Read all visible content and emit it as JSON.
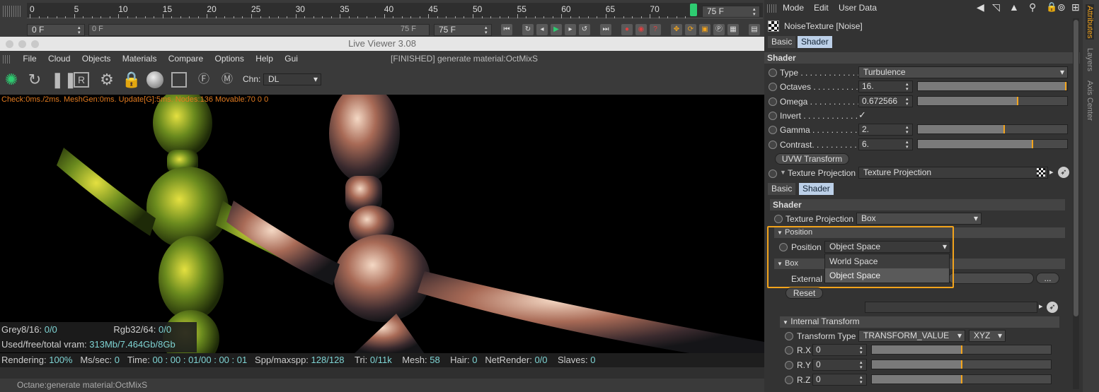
{
  "timeline": {
    "ticks": [
      "0",
      "5",
      "10",
      "15",
      "20",
      "25",
      "30",
      "35",
      "40",
      "45",
      "50",
      "55",
      "60",
      "65",
      "70"
    ],
    "end_frame": "75 F",
    "start_field": "0 F",
    "range_start": "0 F",
    "range_end": "75 F",
    "max_field": "75 F"
  },
  "viewer": {
    "window_title": "Live Viewer 3.08",
    "status_title": "[FINISHED] generate material:OctMixS",
    "menu": [
      "File",
      "Cloud",
      "Objects",
      "Materials",
      "Compare",
      "Options",
      "Help",
      "Gui"
    ],
    "channel_label": "Chn:",
    "channel_value": "DL",
    "check_line": "Check:0ms./2ms. MeshGen:0ms. Update[G]:5ms. Nodes:136 Movable:70  0 0",
    "grey_label": "Grey8/16:",
    "grey_value": "0/0",
    "rgb_label": "Rgb32/64:",
    "rgb_value": "0/0",
    "vram_label": "Used/free/total vram:",
    "vram_value": "313Mb/7.464Gb/8Gb"
  },
  "stats": {
    "rendering_label": "Rendering:",
    "rendering": "100%",
    "mssec_label": "Ms/sec:",
    "mssec": "0",
    "time_label": "Time:",
    "time": "00 : 00 : 01/00 : 00 : 01",
    "spp_label": "Spp/maxspp:",
    "spp": "128/128",
    "tri_label": "Tri:",
    "tri": "0/11k",
    "mesh_label": "Mesh:",
    "mesh": "58",
    "hair_label": "Hair:",
    "hair": "0",
    "netrender_label": "NetRender:",
    "netrender": "0/0",
    "slaves_label": "Slaves:",
    "slaves": "0"
  },
  "statusbar": {
    "text": "Octane:generate material:OctMixS"
  },
  "attributes": {
    "menu": [
      "Mode",
      "Edit",
      "User Data"
    ],
    "object_name": "NoiseTexture [Noise]",
    "tabs": [
      "Basic",
      "Shader"
    ],
    "section": "Shader",
    "params": [
      {
        "label": "Type . . . . . . . . . . . . .",
        "value": "Turbulence"
      },
      {
        "label": "Octaves . . . . . . . . . .",
        "value": "16.",
        "level": 0.99
      },
      {
        "label": "Omega . . . . . . . . . . .",
        "value": "0.672566",
        "level": 0.67
      },
      {
        "label": "Invert . . . . . . . . . . . .",
        "value": "✓"
      },
      {
        "label": "Gamma . . . . . . . . . .",
        "value": "2.",
        "level": 0.58
      },
      {
        "label": "Contrast. . . . . . . . . .",
        "value": "6.",
        "level": 0.77
      }
    ],
    "uvw_button": "UVW Transform",
    "texproj_label": "Texture Projection",
    "texproj_value": "Texture Projection",
    "inner_tabs": [
      "Basic",
      "Shader"
    ],
    "inner_section": "Shader",
    "inner_texproj_label": "Texture Projection",
    "inner_texproj_value": "Box",
    "position_group": "Position",
    "position_label": "Position",
    "position_value": "Object Space",
    "position_options": [
      "World Space",
      "Object Space"
    ],
    "box_group": "Box",
    "external_label": "External",
    "more_button": "...",
    "reset_button": "Reset",
    "internal_transform": "Internal Transform",
    "transform_type_label": "Transform Type",
    "transform_type_value": "TRANSFORM_VALUE",
    "order_value": "XYZ",
    "rotations": [
      {
        "label": "R.X",
        "value": "0"
      },
      {
        "label": "R.Y",
        "value": "0"
      },
      {
        "label": "R.Z",
        "value": "0"
      }
    ]
  },
  "side_tabs": [
    "Attributes",
    "Layers",
    "Axis Center"
  ],
  "colors": {
    "accent": "#f3a41c",
    "selected_tab": "#bcd0e8",
    "stat_value": "#7fd4d4"
  }
}
